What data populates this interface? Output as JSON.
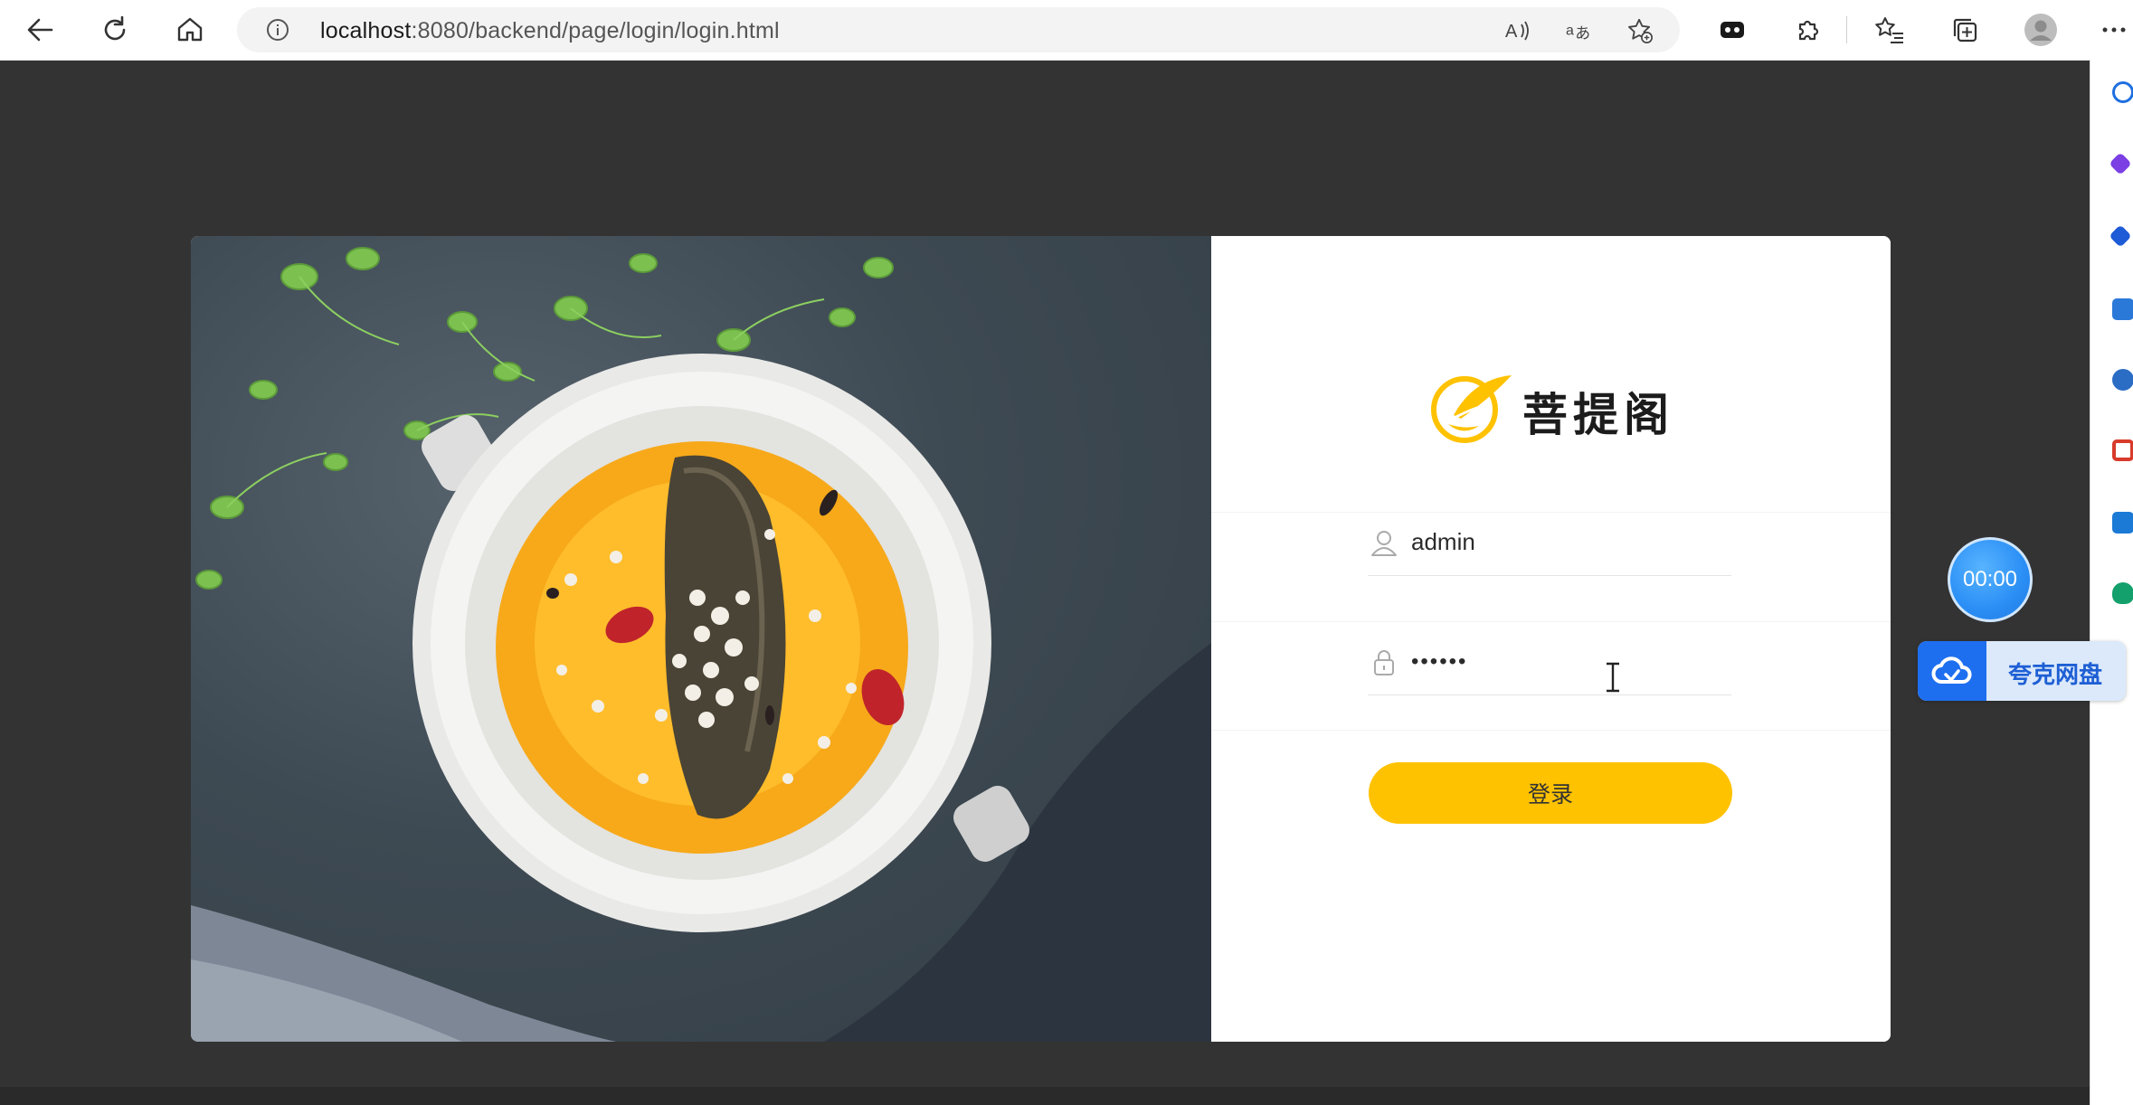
{
  "browser": {
    "url_host": "localhost",
    "url_path": ":8080/backend/page/login/login.html",
    "read_aloud_icon": "read-aloud-icon",
    "translate_icon": "translate-icon",
    "favorite_icon": "add-favorite-icon"
  },
  "login": {
    "brand_name": "菩提阁",
    "username_value": "admin",
    "password_value": "••••••",
    "login_button": "登录"
  },
  "widgets": {
    "timer": "00:00",
    "cloud_drive_label": "夸克网盘"
  },
  "colors": {
    "accent": "#ffc200",
    "page_background": "#333333",
    "cloud_blue": "#1e6ff0"
  }
}
